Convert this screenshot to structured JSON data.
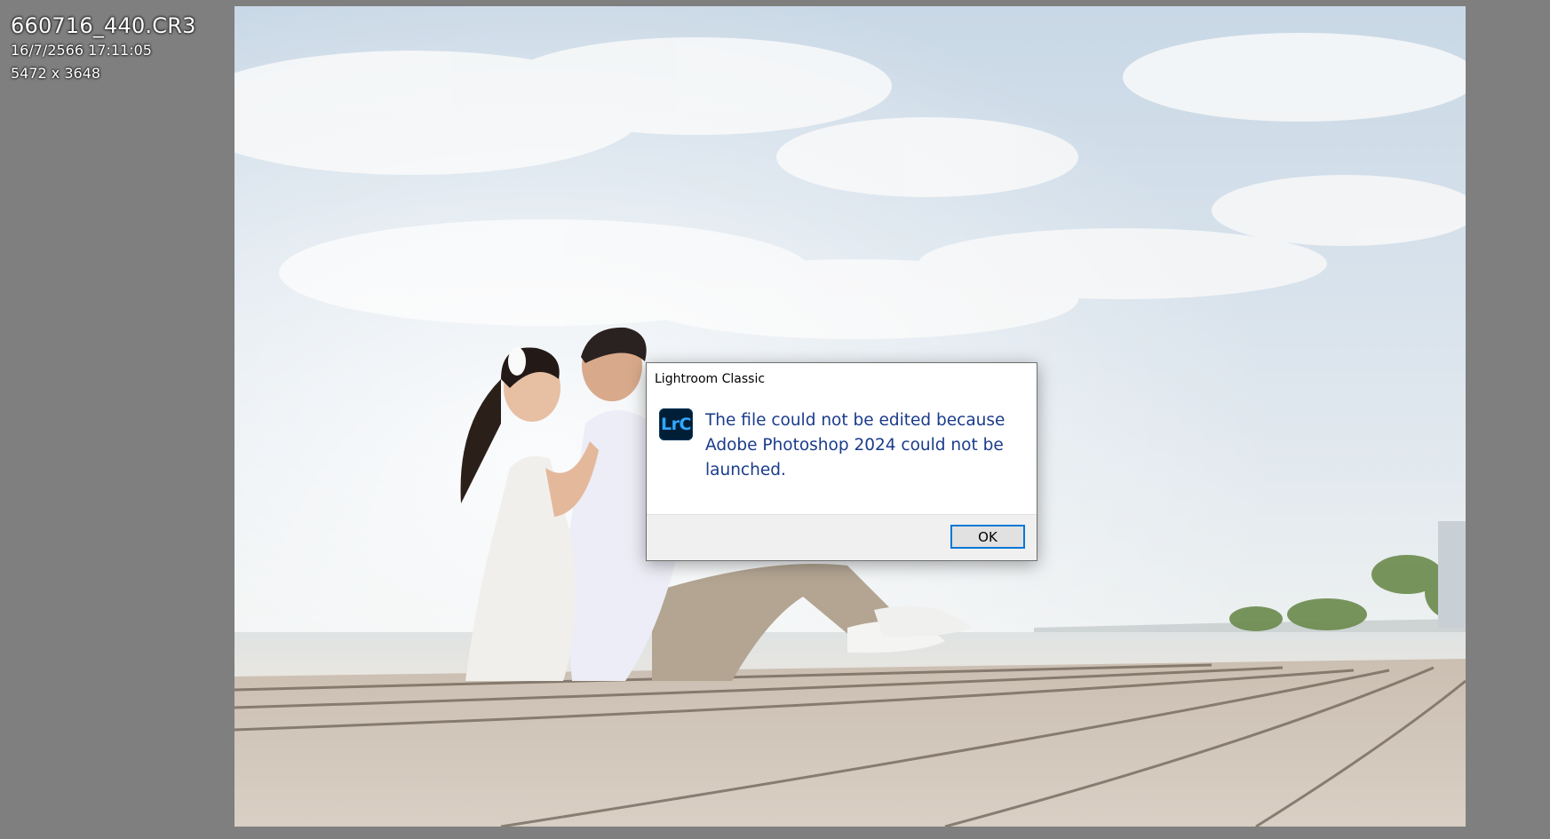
{
  "viewer": {
    "filename": "660716_440.CR3",
    "datetime": "16/7/2566 17:11:05",
    "dimensions": "5472 x 3648"
  },
  "photo": {
    "subject": "photo-couple-on-pier"
  },
  "dialog": {
    "title": "Lightroom Classic",
    "app_icon_text": "LrC",
    "message": "The file could not be edited because Adobe Photoshop 2024 could not be launched.",
    "ok_label": "OK",
    "message_color": "#1a3b8c",
    "button_border_color": "#0078d7"
  }
}
